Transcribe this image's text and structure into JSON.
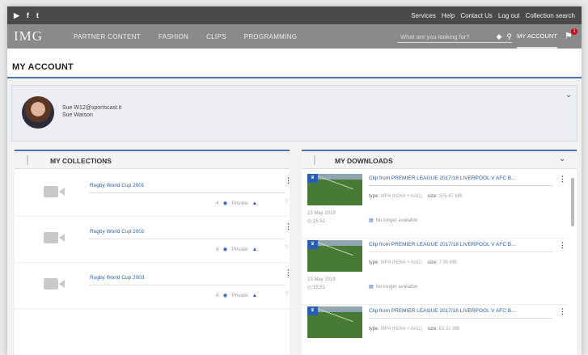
{
  "topbar": {
    "social": [
      "▶",
      "f",
      "t"
    ],
    "links": [
      "Services",
      "Help",
      "Contact Us",
      "Log out",
      "Collection search"
    ]
  },
  "nav": {
    "logo": "IMG",
    "items": [
      "PARTNER CONTENT",
      "FASHION",
      "CLIPS",
      "PROGRAMMING"
    ],
    "search_placeholder": "What are you looking for?",
    "account": "MY ACCOUNT",
    "bell_count": "1"
  },
  "page": {
    "title": "MY ACCOUNT"
  },
  "profile": {
    "email": "Sue W12@sportscast.it",
    "name": "Sue Watson"
  },
  "collections": {
    "title": "MY COLLECTIONS",
    "items": [
      {
        "name": "Rugby World Cup 2001",
        "count": "4",
        "privacy": "Private"
      },
      {
        "name": "Rugby World Cup 2002",
        "count": "4",
        "privacy": "Private"
      },
      {
        "name": "Rugby World Cup 2003",
        "count": "4",
        "privacy": "Private"
      }
    ]
  },
  "downloads": {
    "title": "MY DOWNLOADS",
    "items": [
      {
        "title": "Clip from PREMIER LEAGUE 2017/18 LIVERPOOL V AFC B...",
        "type": "MP4 (H264 + AAC)",
        "size": "375.47 MB",
        "date": "23 May 2019",
        "time": "15:51",
        "status": "No longer available"
      },
      {
        "title": "Clip from PREMIER LEAGUE 2017/18 LIVERPOOL V AFC B...",
        "type": "MP4 (H264 + AAC)",
        "size": "7.95 MB",
        "date": "23 May 2019",
        "time": "15:51",
        "status": "No longer available"
      },
      {
        "title": "Clip from PREMIER LEAGUE 2017/18 LIVERPOOL V AFC B...",
        "type": "MP4 (H264 + AAC)",
        "size": "63.31 MB"
      }
    ]
  },
  "labels": {
    "type": "type:",
    "size": "size:"
  },
  "colors": {
    "accent": "#4a72b5",
    "link": "#2a5db0",
    "nav": "#8a8a8a",
    "topbar": "#4a4a4a"
  }
}
